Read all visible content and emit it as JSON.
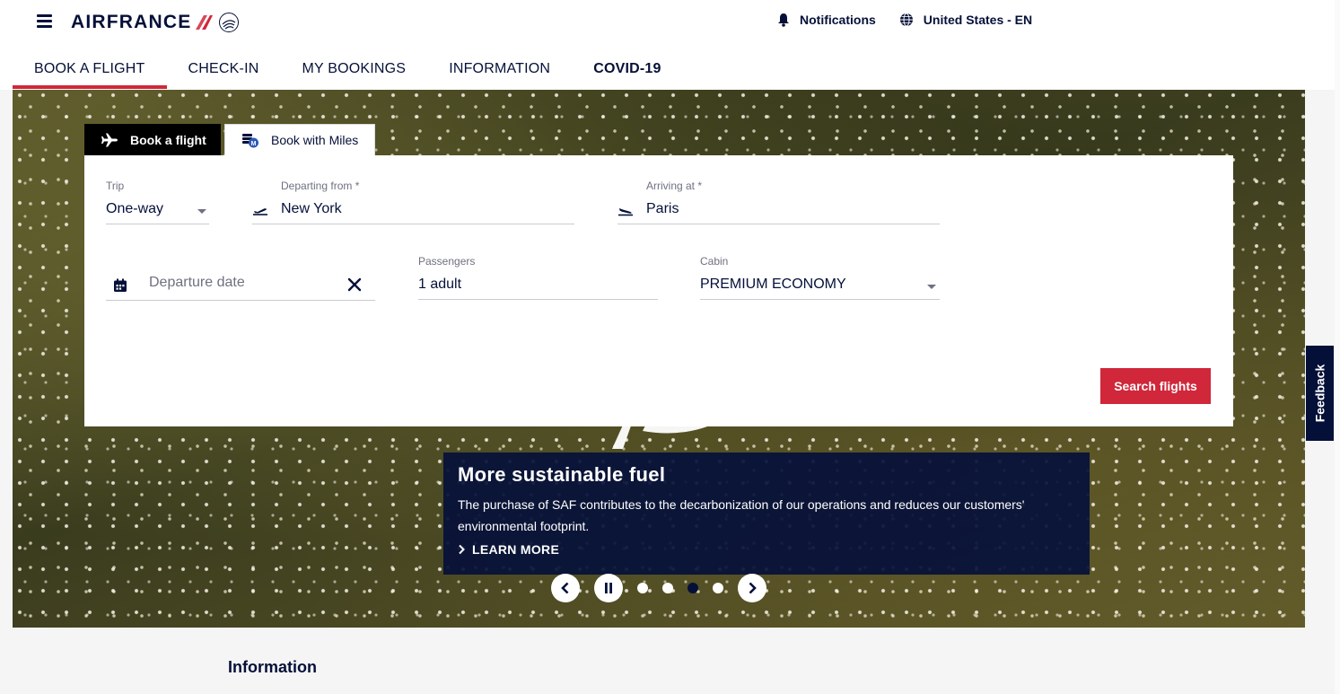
{
  "header": {
    "logo_text": "AIRFRANCE",
    "notifications_label": "Notifications",
    "locale_label": "United States - EN"
  },
  "nav": {
    "items": [
      {
        "label": "BOOK A FLIGHT"
      },
      {
        "label": "CHECK-IN"
      },
      {
        "label": "MY BOOKINGS"
      },
      {
        "label": "INFORMATION"
      },
      {
        "label": "COVID-19"
      }
    ]
  },
  "booking": {
    "tabs": [
      {
        "label": "Book a flight",
        "icon": "airplane-icon"
      },
      {
        "label": "Book with Miles",
        "icon": "miles-icon"
      }
    ],
    "trip": {
      "label": "Trip",
      "value": "One-way"
    },
    "departing": {
      "label": "Departing from *",
      "value": "New York"
    },
    "arriving": {
      "label": "Arriving at *",
      "value": "Paris"
    },
    "departure_date": {
      "placeholder": "Departure date"
    },
    "passengers": {
      "label": "Passengers",
      "value": "1 adult"
    },
    "cabin": {
      "label": "Cabin",
      "value": "PREMIUM ECONOMY"
    },
    "search_label": "Search flights"
  },
  "promo": {
    "title": "More sustainable fuel",
    "text": "The purchase of SAF contributes to the decarbonization of our operations and reduces our customers' environmental footprint.",
    "link_label": "LEARN MORE"
  },
  "carousel": {
    "slide_count": 4,
    "active_index": 2
  },
  "feedback_label": "Feedback",
  "info_title": "Information",
  "colors": {
    "navy": "#051039",
    "red": "#d0273a"
  }
}
